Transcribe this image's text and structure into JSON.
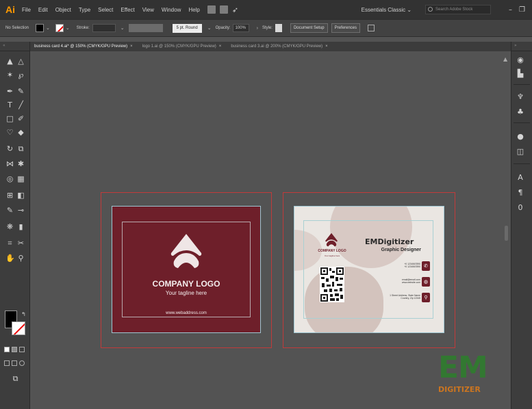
{
  "app": {
    "logo": "Ai"
  },
  "menu": [
    "File",
    "Edit",
    "Object",
    "Type",
    "Select",
    "Effect",
    "View",
    "Window",
    "Help"
  ],
  "workspace": {
    "label": "Essentials Classic",
    "chevron": "⌄"
  },
  "search": {
    "placeholder": "Search Adobe Stock"
  },
  "window_controls": {
    "minimize": "–",
    "restore": "❐"
  },
  "control_bar": {
    "selection": "No Selection",
    "stroke_label": "Stroke:",
    "brush": "5 pt. Round",
    "opacity_label": "Opacity:",
    "opacity_value": "100%",
    "style_label": "Style:",
    "document_setup": "Document Setup",
    "preferences": "Preferences"
  },
  "tabs": [
    {
      "label": "business card 4.ai* @ 150% (CMYK/GPU Preview)",
      "active": true
    },
    {
      "label": "logo 1.ai @ 150% (CMYK/GPU Preview)",
      "active": false
    },
    {
      "label": "business card 3.ai @ 200% (CMYK/GPU Preview)",
      "active": false
    }
  ],
  "tab_close": "×",
  "toolbar": {
    "collapse": "«"
  },
  "panels": {
    "collapse": "»"
  },
  "card_front": {
    "company": "COMPANY LOGO",
    "tagline": "Your tagline here",
    "website": "www.webaddress.com",
    "color": "#6e1f2a"
  },
  "card_back": {
    "company": "COMPANY LOGO",
    "tagline": "Your tagline here",
    "name": "EMDigitizer",
    "title": "Graphic Designer",
    "phone1": "+0 1234567890",
    "phone2": "+0 1234567890",
    "email": "email@email.com",
    "web": "www.website.com",
    "address1": "1 Street Address, State Name",
    "address2": "Country, Zip 12345",
    "accent": "#6e1f2a"
  },
  "watermark": {
    "main": "EM",
    "sub": "DIGITIZER"
  }
}
